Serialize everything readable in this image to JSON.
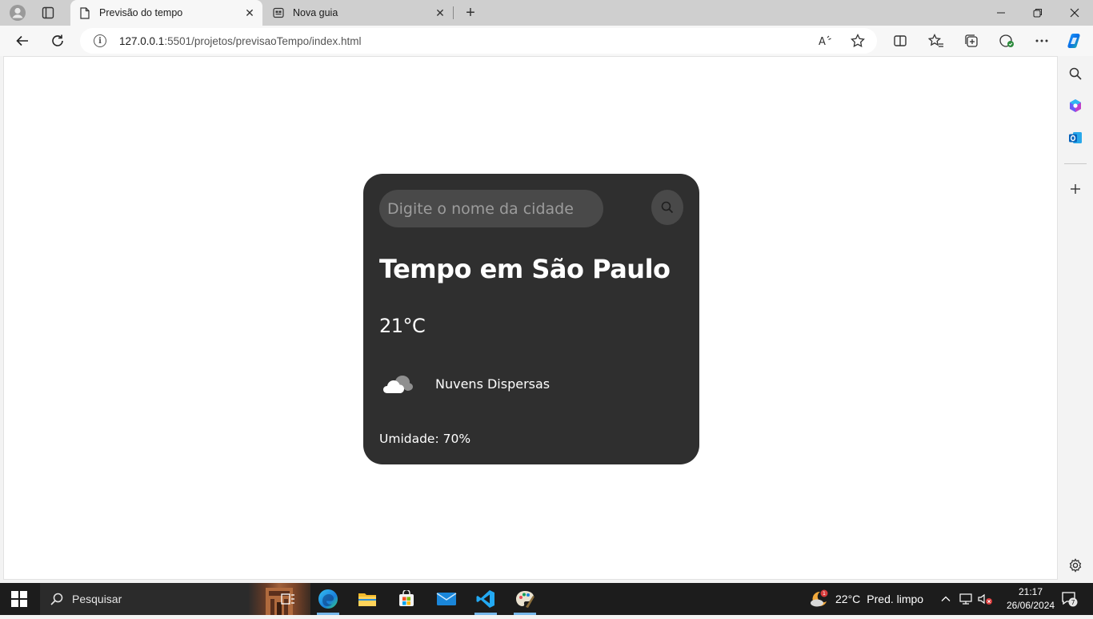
{
  "browser": {
    "tabs": [
      {
        "title": "Previsão do tempo",
        "active": true
      },
      {
        "title": "Nova guia",
        "active": false
      }
    ],
    "url_host": "127.0.0.1",
    "url_rest": ":5501/projetos/previsaoTempo/index.html"
  },
  "weather_app": {
    "search_placeholder": "Digite o nome da cidade",
    "title": "Tempo em São Paulo",
    "temperature": "21°C",
    "description": "Nuvens Dispersas",
    "humidity": "Umidade: 70%",
    "icon": "cloud-icon"
  },
  "taskbar": {
    "search_label": "Pesquisar",
    "weather_temp": "22°C",
    "weather_text": "Pred. limpo",
    "weather_badge": "1",
    "time": "21:17",
    "date": "26/06/2024",
    "notifications": "7"
  },
  "colors": {
    "card_bg": "#2f2f2f",
    "input_bg": "#494949",
    "taskbar_bg": "#1c1c1c",
    "accent": "#0078d4"
  }
}
